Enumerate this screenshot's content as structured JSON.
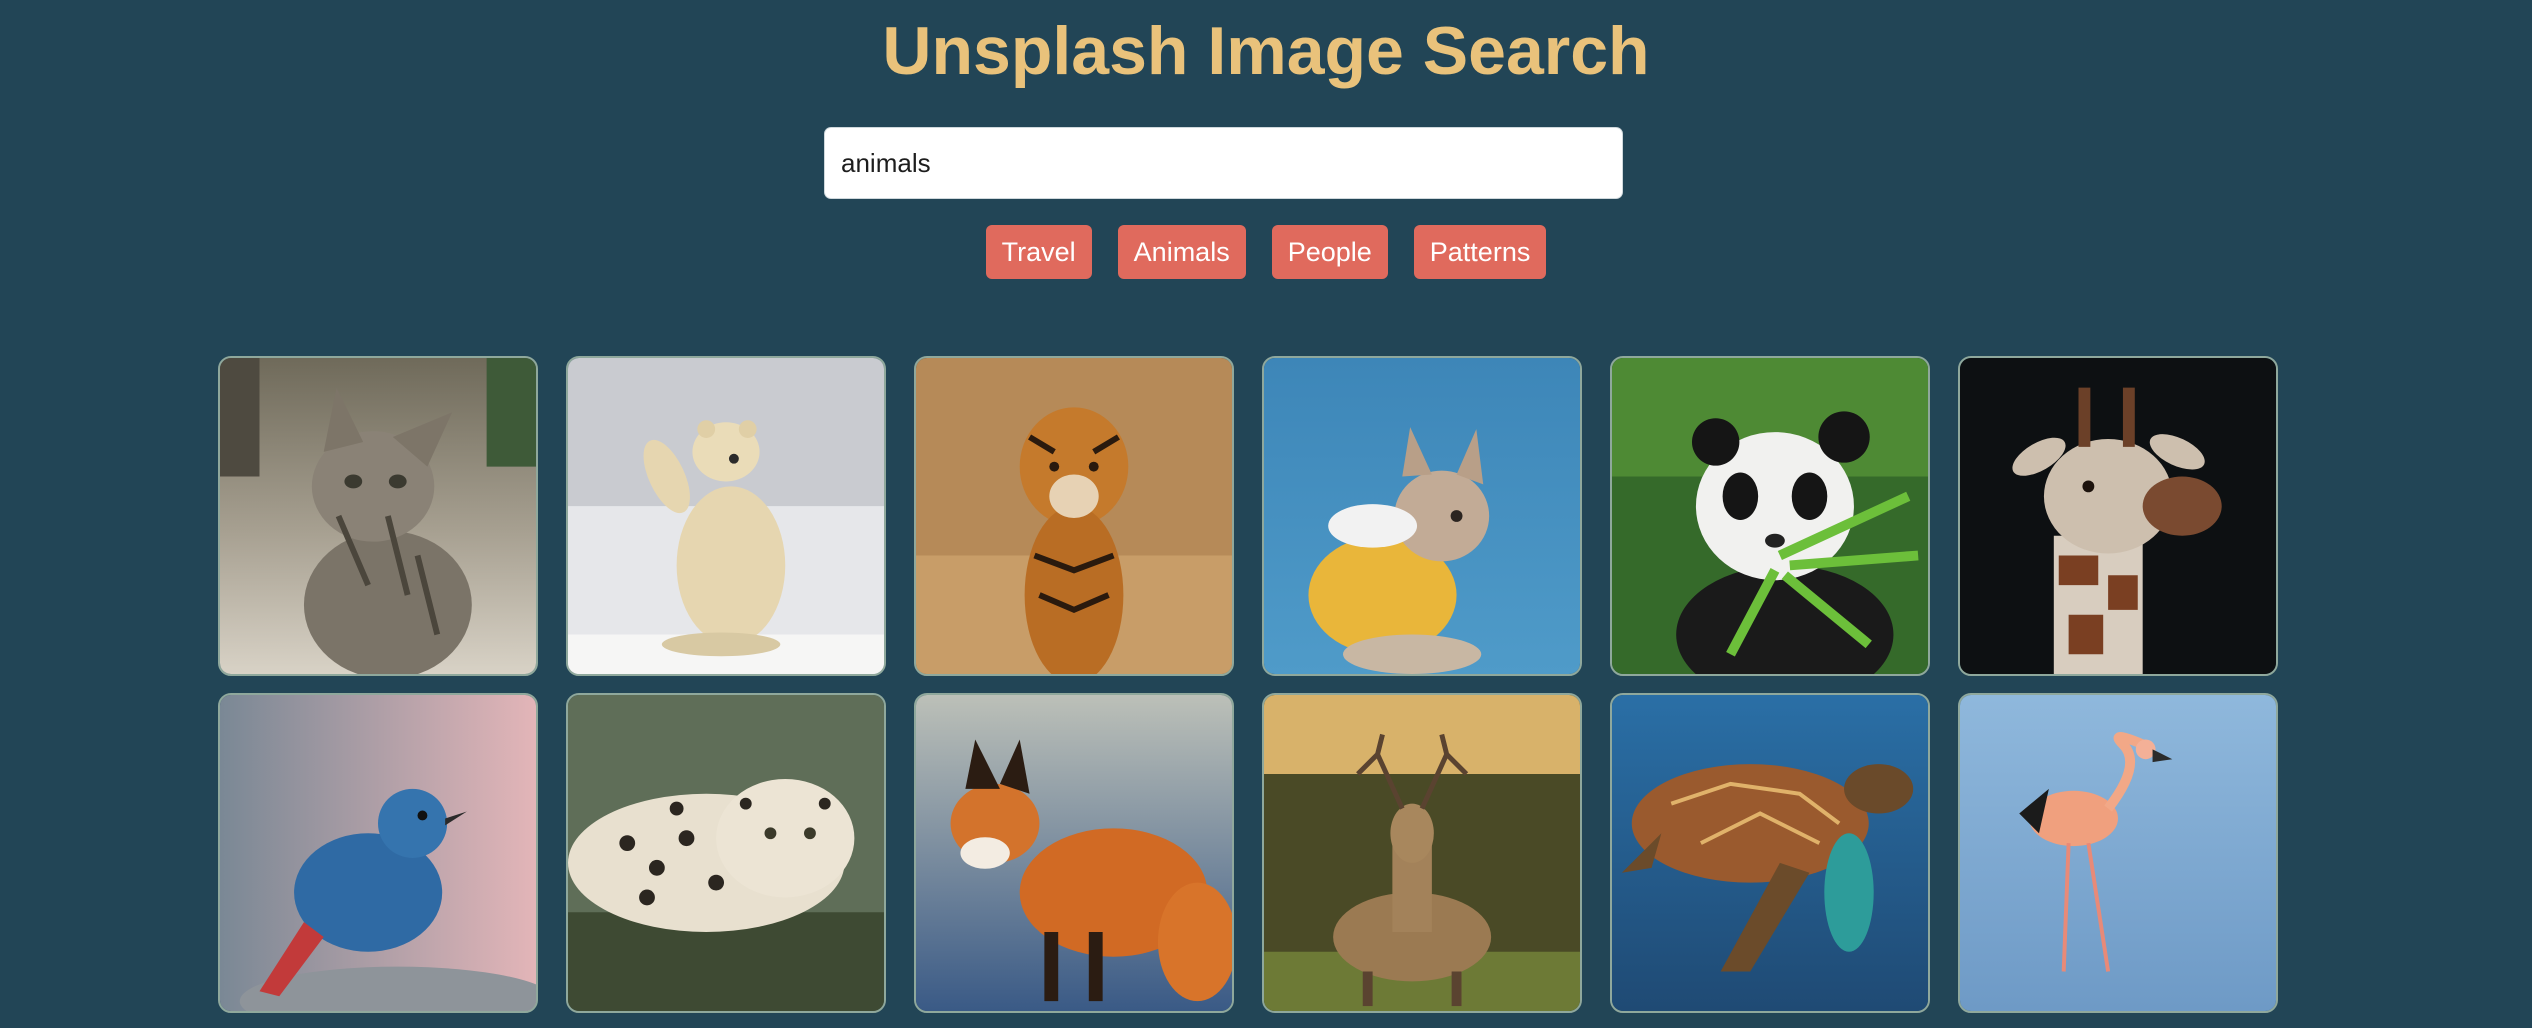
{
  "header": {
    "title": "Unsplash Image Search"
  },
  "search": {
    "value": "animals"
  },
  "filters": [
    {
      "label": "Travel"
    },
    {
      "label": "Animals"
    },
    {
      "label": "People"
    },
    {
      "label": "Patterns"
    }
  ],
  "results": [
    {
      "subject": "kitten",
      "icon": "kitten-photo"
    },
    {
      "subject": "polar bear",
      "icon": "polar-bear-photo"
    },
    {
      "subject": "tiger",
      "icon": "tiger-photo"
    },
    {
      "subject": "french bulldog",
      "icon": "dog-photo"
    },
    {
      "subject": "panda",
      "icon": "panda-photo"
    },
    {
      "subject": "giraffe",
      "icon": "giraffe-photo"
    },
    {
      "subject": "blue bird",
      "icon": "bird-photo"
    },
    {
      "subject": "leopard",
      "icon": "leopard-photo"
    },
    {
      "subject": "fox",
      "icon": "fox-photo"
    },
    {
      "subject": "deer",
      "icon": "deer-photo"
    },
    {
      "subject": "sea turtle",
      "icon": "turtle-photo"
    },
    {
      "subject": "flamingo",
      "icon": "flamingo-photo"
    }
  ],
  "colors": {
    "background": "#224556",
    "title": "#e9c27b",
    "tag": "#e06a5d"
  }
}
